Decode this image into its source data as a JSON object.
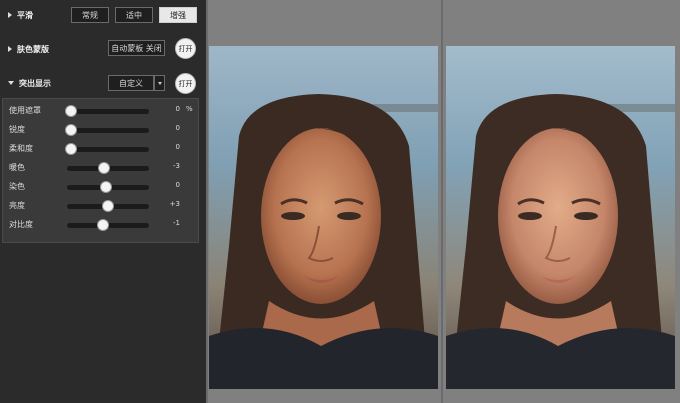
{
  "smoothing": {
    "title": "平滑",
    "options": [
      {
        "label": "常规",
        "active": false
      },
      {
        "label": "适中",
        "active": false
      },
      {
        "label": "增强",
        "active": true
      }
    ]
  },
  "skin_mask": {
    "title": "肤色蒙版",
    "auto_mask_button": "自动蒙板 关闭",
    "open_button": "打开"
  },
  "highlight": {
    "title": "突出显示",
    "preset": "自定义",
    "open_button": "打开",
    "sliders": [
      {
        "label": "使用遮罩",
        "value": "0",
        "unit": "%",
        "level": 0.0
      },
      {
        "label": "锐度",
        "value": "0",
        "unit": "",
        "level": 0.0
      },
      {
        "label": "柔和度",
        "value": "0",
        "unit": "",
        "level": 0.0
      },
      {
        "label": "暖色",
        "value": "-3",
        "unit": "",
        "level": 0.47
      },
      {
        "label": "染色",
        "value": "0",
        "unit": "",
        "level": 0.5
      },
      {
        "label": "亮度",
        "value": "+3",
        "unit": "",
        "level": 0.53
      },
      {
        "label": "对比度",
        "value": "-1",
        "unit": "",
        "level": 0.45
      }
    ]
  },
  "colors": {
    "panel_bg": "#2b2b2b",
    "workspace_bg": "#808080",
    "knob": "#f4f4f4"
  },
  "preview": {
    "before_image": "portrait-before",
    "after_image": "portrait-after"
  }
}
